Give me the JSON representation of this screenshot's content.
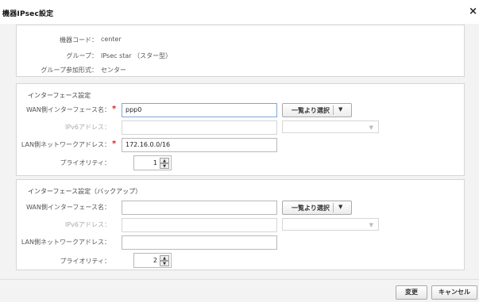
{
  "dialog": {
    "title": "機器IPsec設定",
    "close_label": "×"
  },
  "info": {
    "device_code": {
      "label": "機器コード：",
      "value": "center"
    },
    "group": {
      "label": "グループ：",
      "value": "IPsec star （スター型）"
    },
    "group_type": {
      "label": "グループ参加形式：",
      "value": "センター"
    }
  },
  "primary": {
    "section_title": "インターフェース設定",
    "wan_if": {
      "label": "WAN側インターフェース名：",
      "required_mark": "*",
      "value": "ppp0"
    },
    "select_button": {
      "label": "一覧より選択",
      "dropdown": "▼"
    },
    "ipv6": {
      "label": "IPv6アドレス：",
      "value": ""
    },
    "ipv6_select": {
      "value": "",
      "arrow": "▼"
    },
    "lan_net": {
      "label": "LAN側ネットワークアドレス：",
      "required_mark": "*",
      "value": "172.16.0.0/16"
    },
    "priority": {
      "label": "プライオリティ：",
      "value": "1"
    }
  },
  "backup": {
    "section_title": "インターフェース設定（バックアップ）",
    "wan_if": {
      "label": "WAN側インターフェース名：",
      "value": ""
    },
    "select_button": {
      "label": "一覧より選択",
      "dropdown": "▼"
    },
    "ipv6": {
      "label": "IPv6アドレス：",
      "value": ""
    },
    "ipv6_select": {
      "value": "",
      "arrow": "▼"
    },
    "lan_net": {
      "label": "LAN側ネットワークアドレス：",
      "value": ""
    },
    "priority": {
      "label": "プライオリティ：",
      "value": "2"
    }
  },
  "footer": {
    "change_label": "変更",
    "cancel_label": "キャンセル"
  },
  "spinner": {
    "up": "▲",
    "down": "▼"
  }
}
